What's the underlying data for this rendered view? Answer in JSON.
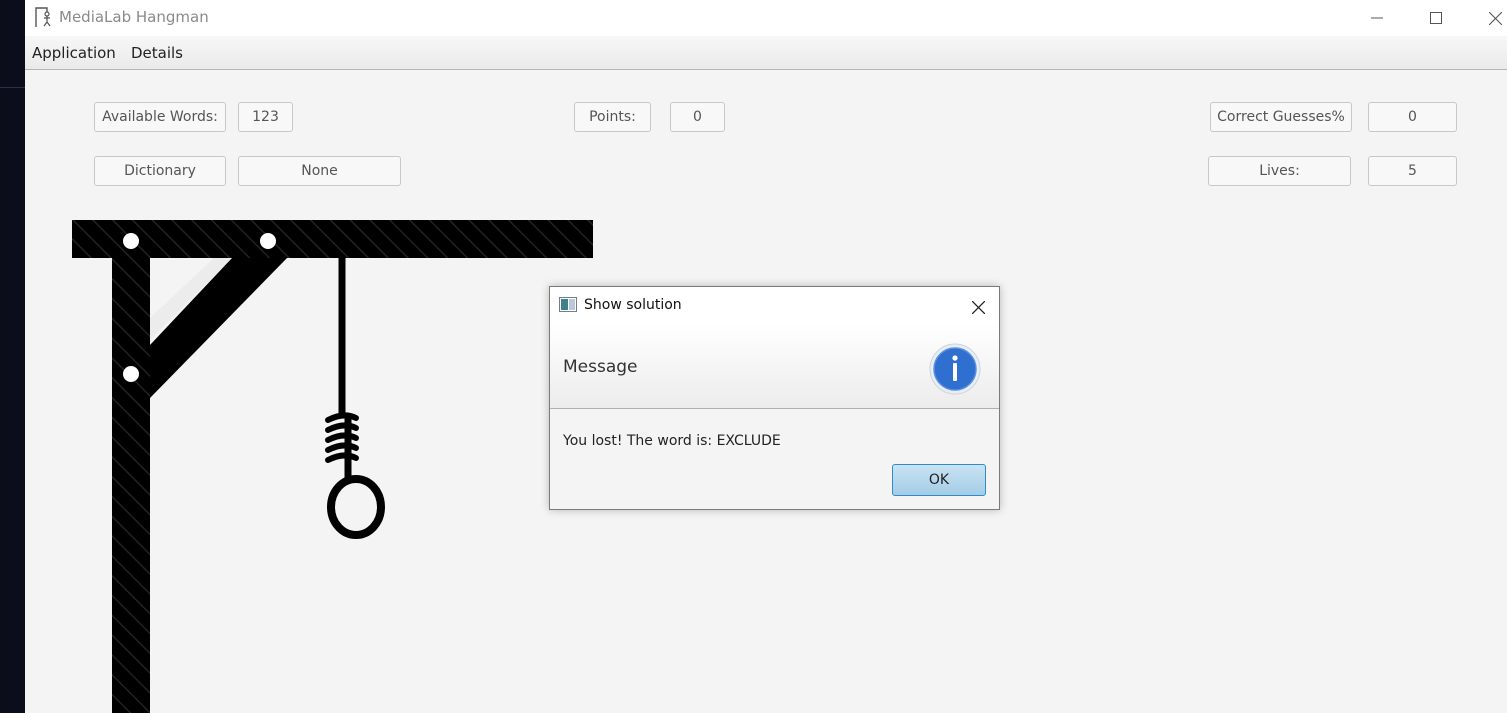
{
  "window": {
    "title": "MediaLab Hangman"
  },
  "menu": {
    "items": [
      "Application",
      "Details"
    ]
  },
  "stats": {
    "available_words_label": "Available Words:",
    "available_words_value": "123",
    "points_label": "Points:",
    "points_value": "0",
    "correct_guesses_label": "Correct Guesses%",
    "correct_guesses_value": "0",
    "dictionary_label": "Dictionary",
    "dictionary_value": "None",
    "lives_label": "Lives:",
    "lives_value": "5"
  },
  "dialog": {
    "title": "Show solution",
    "header": "Message",
    "content": "You lost! The word is: EXCLUDE",
    "ok_label": "OK",
    "icon": "info-icon"
  },
  "colors": {
    "ok_border": "#2f8dc6",
    "info_blue": "#2f6fd0"
  }
}
